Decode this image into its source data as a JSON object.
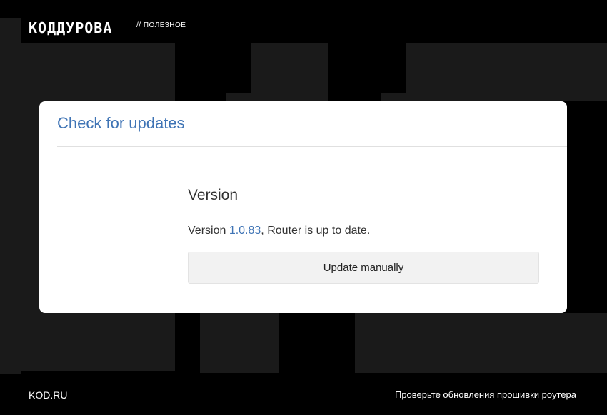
{
  "header": {
    "logo": "КОДДУРОВА",
    "section": "// ПОЛЕЗНОЕ"
  },
  "card": {
    "title": "Check for updates",
    "section_heading": "Version",
    "status_prefix": "Version ",
    "version": "1.0.83",
    "status_suffix": ", Router is up to date.",
    "update_button": "Update manually"
  },
  "footer": {
    "site": "KOD.RU",
    "caption": "Проверьте обновления прошивки роутера"
  },
  "colors": {
    "accent": "#3f74b5",
    "background": "#000000",
    "background_blocks": "#1a1a1a",
    "card": "#ffffff"
  }
}
